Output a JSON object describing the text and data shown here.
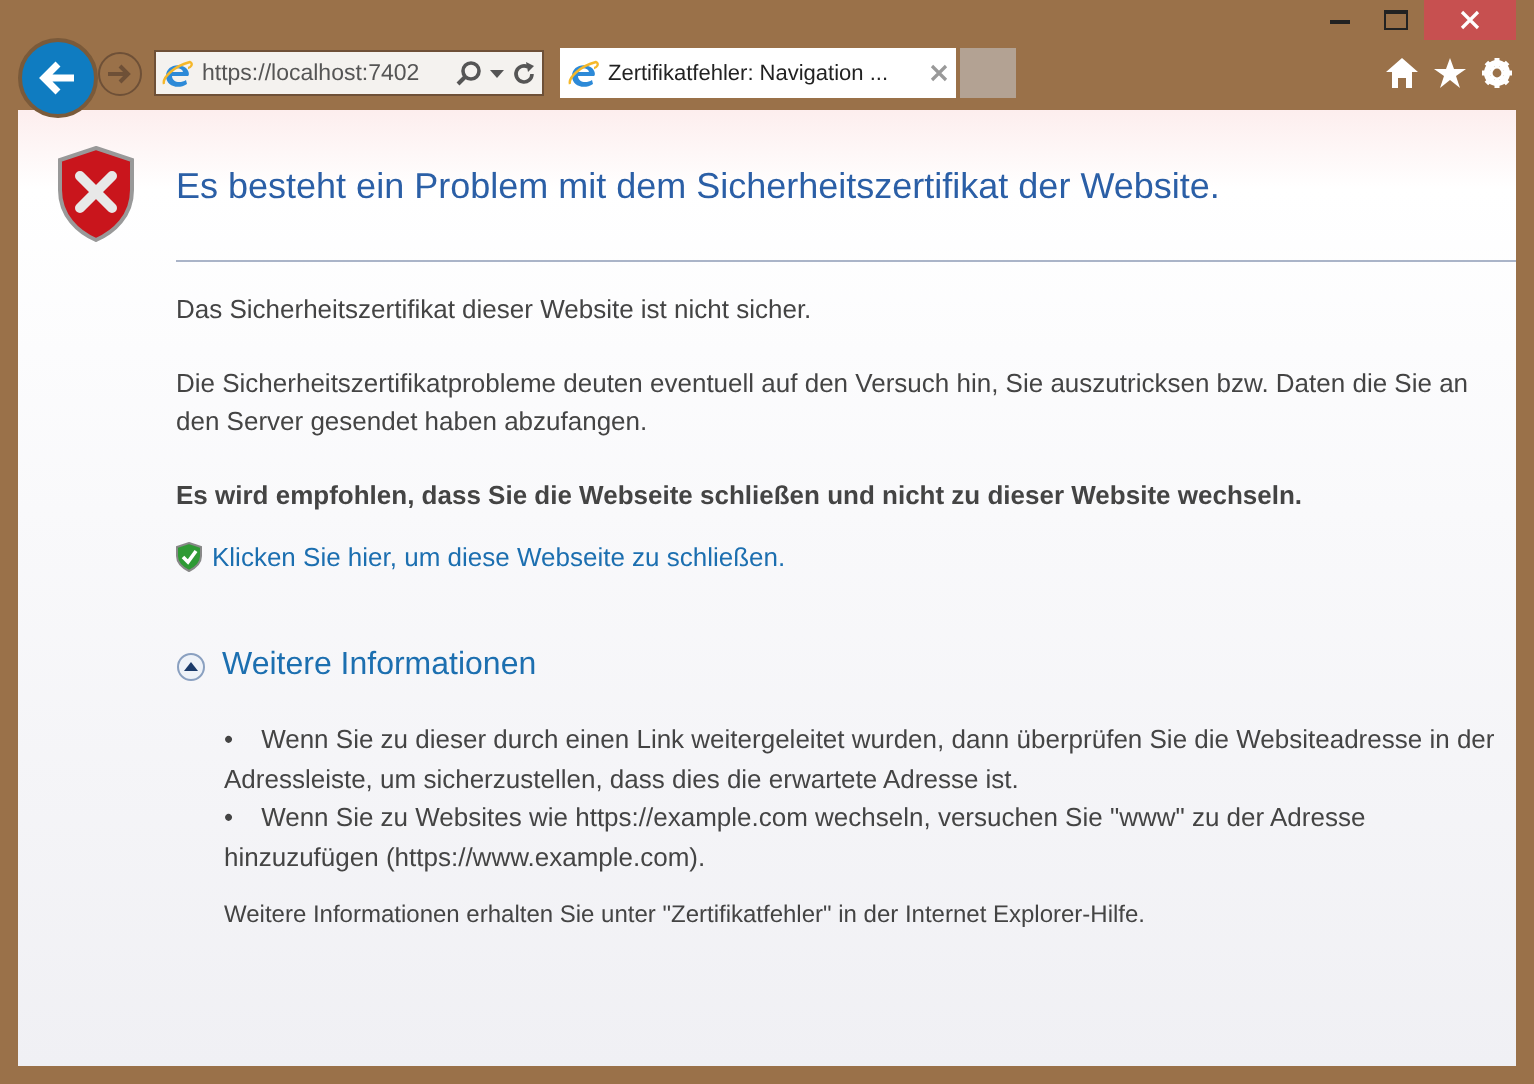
{
  "browser": {
    "address": "https://localhost:7402",
    "tabs": [
      {
        "title": "Zertifikatfehler: Navigation ...",
        "selected": true
      }
    ]
  },
  "page": {
    "title": "Es besteht ein Problem mit dem Sicherheitszertifikat der Website.",
    "paragraphs": [
      {
        "text": "Das Sicherheitszertifikat dieser Website ist nicht sicher.",
        "bold": false
      },
      {
        "text": "Die Sicherheitszertifikatprobleme deuten eventuell auf den Versuch hin, Sie auszutricksen bzw. Daten die Sie an den Server gesendet haben abzufangen.",
        "bold": false
      },
      {
        "text": "Es wird empfohlen, dass Sie die Webseite schließen und nicht zu dieser Website wechseln.",
        "bold": true
      }
    ],
    "close_link": "Klicken Sie hier, um diese Webseite zu schließen.",
    "more_info": {
      "title": "Weitere Informationen",
      "expanded": true,
      "items": [
        {
          "marker": "•",
          "text": "Wenn Sie zu dieser durch einen Link weitergeleitet wurden, dann überprüfen Sie die Websiteadresse in der Adressleiste, um sicherzustellen, dass dies die erwartete Adresse ist."
        },
        {
          "marker": "•",
          "text": "Wenn Sie zu Websites wie https://example.com wechseln, versuchen Sie \"www\" zu der Adresse hinzuzufügen (https://www.example.com)."
        }
      ],
      "footer": "Weitere Informationen erhalten Sie unter \"Zertifikatfehler\" in der Internet Explorer-Hilfe."
    }
  }
}
